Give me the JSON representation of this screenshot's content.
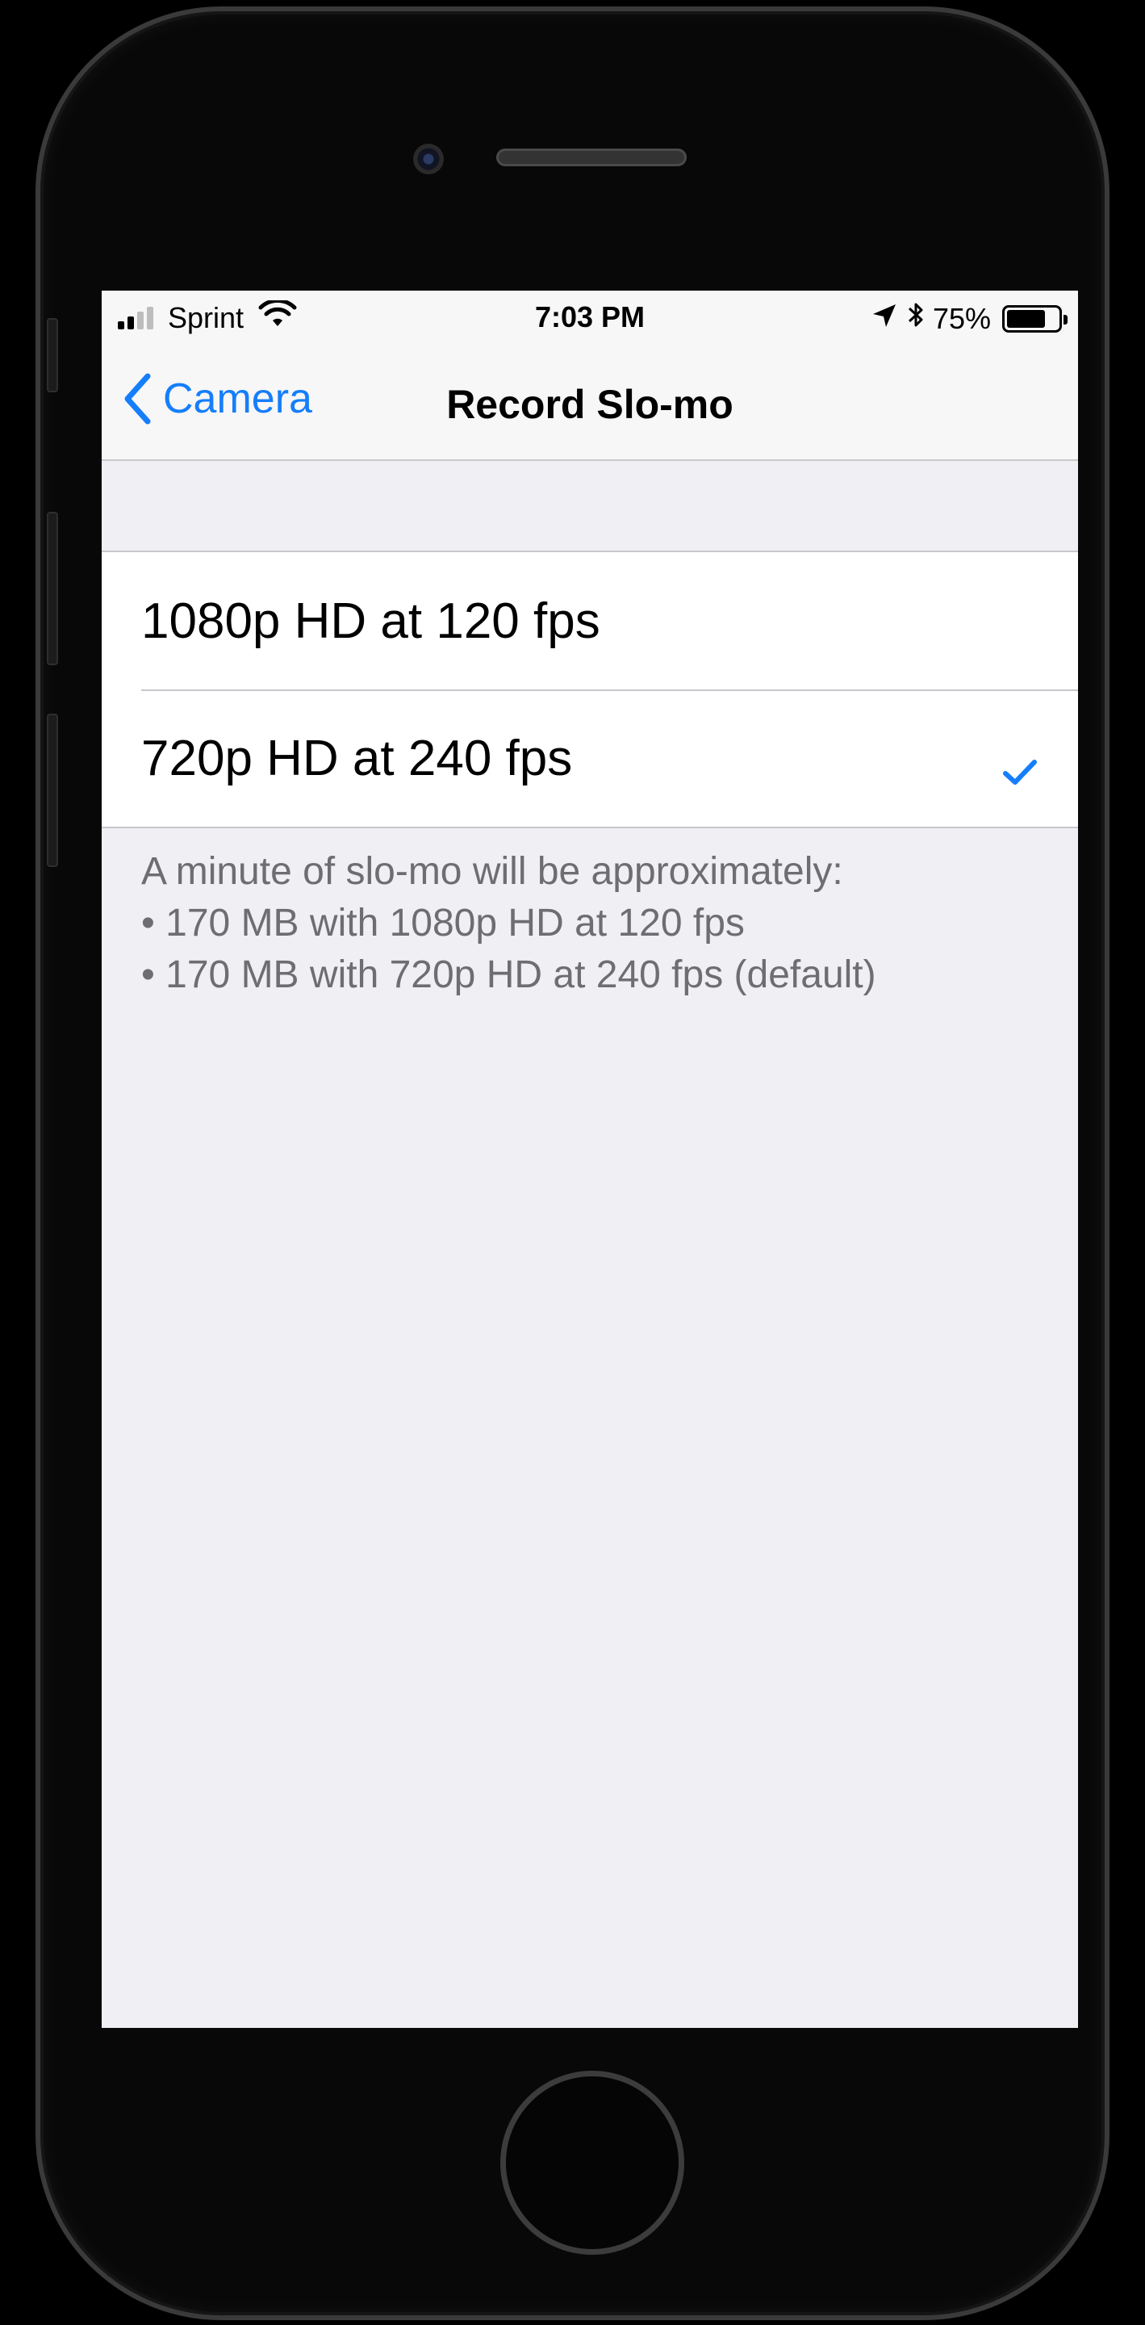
{
  "status_bar": {
    "carrier": "Sprint",
    "time": "7:03 PM",
    "battery_percent": "75%",
    "battery_level": 0.75,
    "signal_bars_filled": 2,
    "signal_bars_total": 4,
    "icons": [
      "signal-icon",
      "wifi-icon",
      "location-icon",
      "bluetooth-icon",
      "battery-icon"
    ]
  },
  "nav": {
    "back_label": "Camera",
    "title": "Record Slo-mo"
  },
  "options": [
    {
      "label": "1080p HD at 120 fps",
      "selected": false
    },
    {
      "label": "720p HD at 240 fps",
      "selected": true
    }
  ],
  "footer": {
    "intro": "A minute of slo-mo will be approximately:",
    "lines": [
      "• 170 MB with 1080p HD at 120 fps",
      "• 170 MB with 720p HD at 240 fps (default)"
    ]
  },
  "colors": {
    "accent": "#157efb",
    "background": "#efeff4",
    "separator": "#c8c7cc",
    "footer_text": "#6d6d72"
  }
}
